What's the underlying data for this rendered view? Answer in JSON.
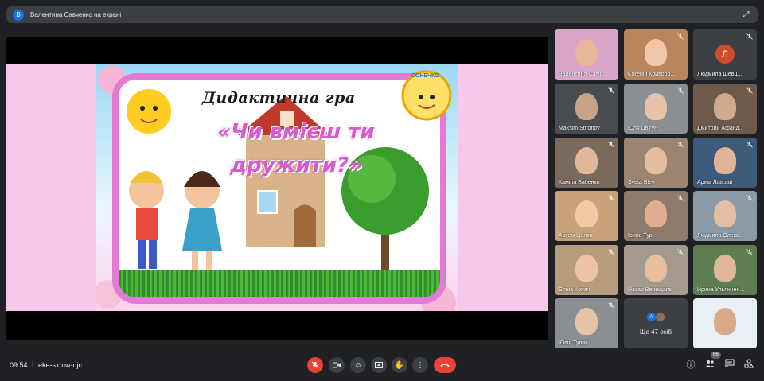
{
  "topbar": {
    "presenter_initial": "В",
    "presenter_text": "Валентина Савченко на екрані"
  },
  "slide": {
    "title": "Дидактична гра",
    "question": "«Чи вмієш ти дружити?»",
    "logo_text": "СОНЕЧКО"
  },
  "tiles": [
    {
      "name": "Валентина Савч...",
      "bg": "#d9a5c8",
      "face": "#e8b59a",
      "muted": false
    },
    {
      "name": "Євгенія Криворо...",
      "bg": "#b8855d",
      "face": "#f1c7a8",
      "muted": true
    },
    {
      "name": "Людмила Шевц...",
      "bg": "#3c4043",
      "avatar": "Л",
      "muted": true
    },
    {
      "name": "Maksim Strionov",
      "bg": "#4a4d4f",
      "face": "#c9a389",
      "muted": true
    },
    {
      "name": "Юля Цвігун",
      "bg": "#8a8f94",
      "face": "#e6c2a8",
      "muted": true
    },
    {
      "name": "Дмитрий Афанд...",
      "bg": "#6d5a4a",
      "face": "#cfa98d",
      "muted": true
    },
    {
      "name": "Каміла Бабенко",
      "bg": "#7a6a5c",
      "face": "#e1b79a",
      "muted": true
    },
    {
      "name": "Sveta Blev",
      "bg": "#9c8570",
      "face": "#e4bc9e",
      "muted": true
    },
    {
      "name": "Аріна Лавізай",
      "bg": "#3d5a7a",
      "face": "#e0b496",
      "muted": true
    },
    {
      "name": "Артем Цапко",
      "bg": "#c9a27a",
      "face": "#f0c9a7",
      "muted": true
    },
    {
      "name": "Ірина Тур",
      "bg": "#8e7b69",
      "face": "#dfae92",
      "muted": true
    },
    {
      "name": "Людмила Олекс...",
      "bg": "#8a9aa6",
      "face": "#e2bfa4",
      "muted": true
    },
    {
      "name": "Еліна Копач",
      "bg": "#b79c7d",
      "face": "#ecc4a4",
      "muted": true
    },
    {
      "name": "Назар Верещага",
      "bg": "#a49a8f",
      "face": "#e5bf9f",
      "muted": true
    },
    {
      "name": "Ирина Ульянчен...",
      "bg": "#5f7d52",
      "face": "#e0b799",
      "muted": true
    },
    {
      "name": "Юлія Тупик",
      "bg": "#8b8f93",
      "face": "#e7c3a6",
      "muted": true
    },
    {
      "name": "",
      "more": "Ще 47 осіб",
      "more_initial": "А",
      "bg": "#3c4043",
      "muted": false
    },
    {
      "name": "",
      "bg": "#e8f0f6",
      "face": "#d9a98a",
      "muted": false
    }
  ],
  "bottombar": {
    "time": "09:54",
    "separator": "|",
    "meeting_code": "eke-sxmw-ojc",
    "participants_count": "66"
  },
  "icons": {
    "mic": "mic-off-icon",
    "cam": "videocam-icon",
    "emoji": "emoji-icon",
    "present": "present-icon",
    "hand": "raise-hand-icon",
    "more": "more-vert-icon",
    "hangup": "call-end-icon",
    "info": "info-icon",
    "people": "people-icon",
    "chat": "chat-icon",
    "activities": "activities-icon"
  }
}
